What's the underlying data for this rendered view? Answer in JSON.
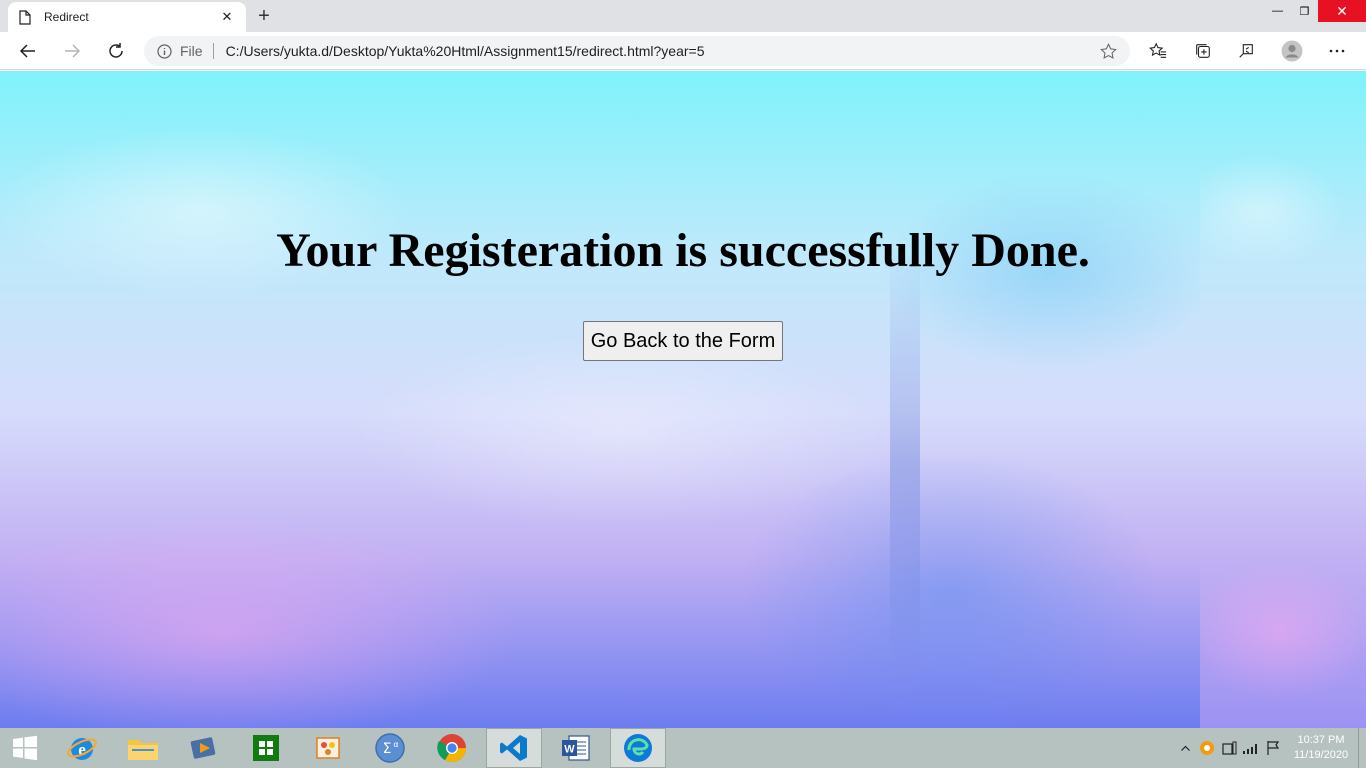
{
  "browser": {
    "tab": {
      "title": "Redirect",
      "close_glyph": "✕",
      "favicon": "page-icon"
    },
    "new_tab_glyph": "+",
    "window_controls": {
      "minimize": "—",
      "restore": "❐",
      "close": "✕"
    },
    "address_bar": {
      "scheme_label": "File",
      "url": "C:/Users/yukta.d/Desktop/Yukta%20Html/Assignment15/redirect.html?year=5"
    },
    "icons": [
      "back-icon",
      "forward-icon",
      "refresh-icon",
      "info-icon",
      "favorite-star-icon",
      "favorites-icon",
      "collections-icon",
      "share-icon",
      "profile-icon",
      "more-icon"
    ]
  },
  "page": {
    "headline": "Your Registeration is successfully Done.",
    "button_label": "Go Back to the Form"
  },
  "taskbar": {
    "items": [
      "start-icon",
      "internet-explorer-icon",
      "file-explorer-icon",
      "media-player-icon",
      "store-icon",
      "paint-icon",
      "math-input-icon",
      "chrome-icon",
      "vscode-icon",
      "word-icon",
      "edge-icon"
    ],
    "active_item": "edge-icon",
    "tray": {
      "time": "10:37 PM",
      "date": "11/19/2020"
    },
    "colors": {
      "background": "#b6c2bf",
      "close_button": "#e81123"
    }
  }
}
